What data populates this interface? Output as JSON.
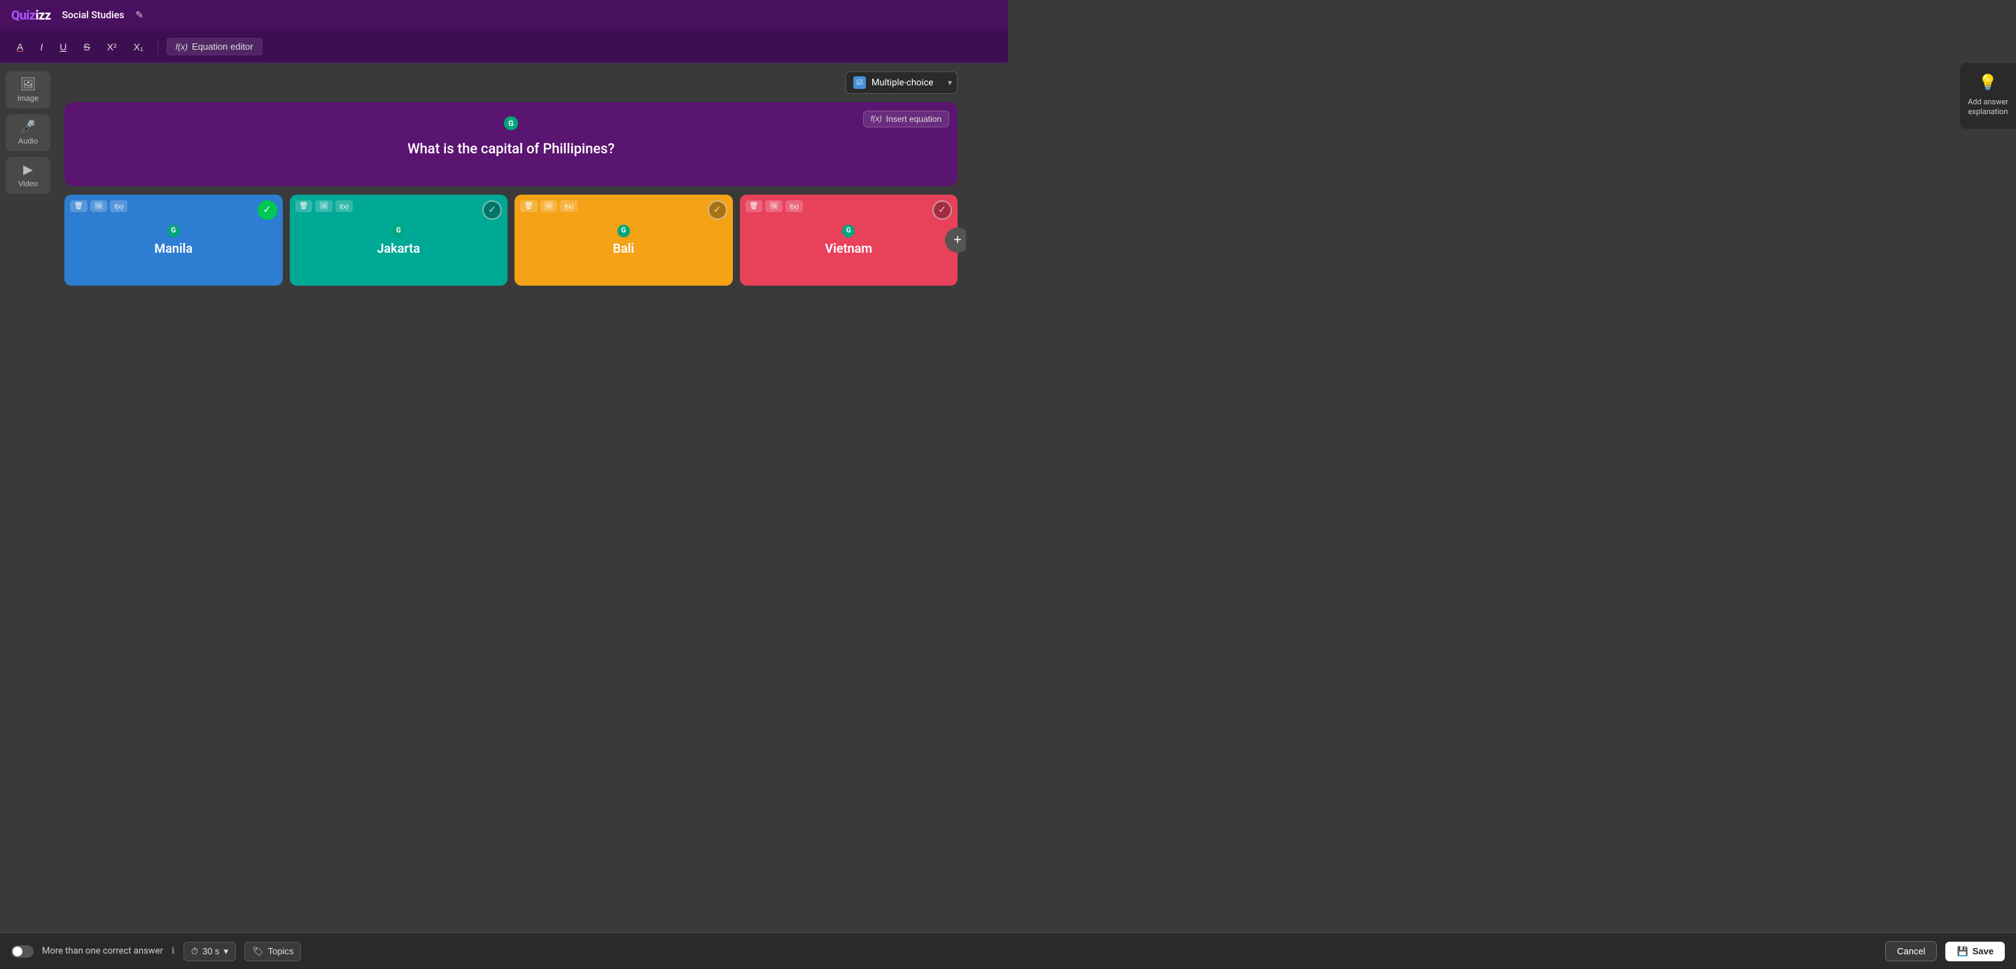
{
  "app": {
    "logo": "Quizizz",
    "quiz_title": "Social Studies",
    "edit_icon": "✎"
  },
  "toolbar": {
    "underline_label": "A",
    "italic_label": "I",
    "underline_btn_label": "U",
    "strikethrough_label": "S",
    "superscript_label": "X²",
    "subscript_label": "X₁",
    "equation_editor_label": "Equation editor"
  },
  "question_type": {
    "label": "Multiple-choice",
    "icon": "☑"
  },
  "sidebar": {
    "image_label": "Image",
    "audio_label": "Audio",
    "video_label": "Video"
  },
  "question": {
    "text": "What is the capital of Phillipines?",
    "insert_equation_label": "Insert equation",
    "grammarly_letter": "G"
  },
  "answers": [
    {
      "text": "Manila",
      "color": "blue",
      "correct": true,
      "grammarly": "G"
    },
    {
      "text": "Jakarta",
      "color": "teal",
      "correct": false,
      "grammarly": "G"
    },
    {
      "text": "Bali",
      "color": "orange",
      "correct": false,
      "grammarly": "G"
    },
    {
      "text": "Vietnam",
      "color": "pink",
      "correct": false,
      "grammarly": "G"
    }
  ],
  "bottom_bar": {
    "more_correct_label": "More than one correct answer",
    "timer_label": "30 s",
    "topics_label": "Topics",
    "cancel_label": "Cancel",
    "save_label": "Save"
  },
  "explanation_panel": {
    "icon": "💡",
    "label": "Add answer explanation"
  }
}
